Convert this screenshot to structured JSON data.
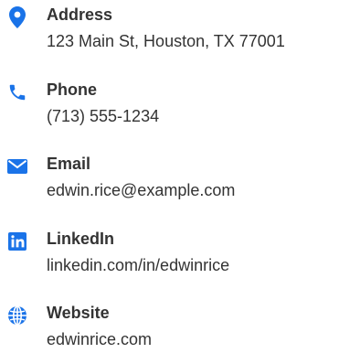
{
  "accent_color": "#1a73e8",
  "contacts": [
    {
      "icon": "map-marker-icon",
      "label": "Address",
      "value": "123 Main St, Houston, TX 77001"
    },
    {
      "icon": "phone-icon",
      "label": "Phone",
      "value": "(713) 555-1234"
    },
    {
      "icon": "envelope-icon",
      "label": "Email",
      "value": "edwin.rice@example.com"
    },
    {
      "icon": "linkedin-icon",
      "label": "LinkedIn",
      "value": "linkedin.com/in/edwinrice"
    },
    {
      "icon": "globe-icon",
      "label": "Website",
      "value": "edwinrice.com"
    }
  ]
}
